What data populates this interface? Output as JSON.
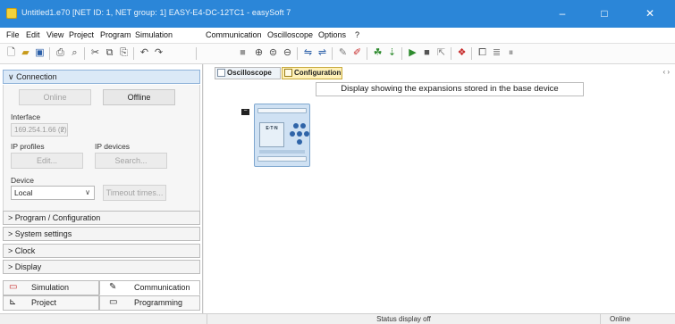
{
  "window": {
    "title": "Untitled1.e70 [NET ID: 1, NET group: 1] EASY-E4-DC-12TC1 - easySoft 7",
    "minimize": "–",
    "maximize": "□",
    "close": "✕",
    "titlebar_color": "#2b86d8"
  },
  "menu": {
    "items": [
      "File",
      "Edit",
      "View",
      "Project",
      "Program",
      "Simulation",
      "Communication",
      "Oscilloscope",
      "Options",
      "?"
    ]
  },
  "toolbar": {
    "icons": [
      "new-file-icon",
      "open-folder-icon",
      "save-icon",
      "print-icon",
      "print-preview-icon",
      "cut-icon",
      "copy-icon",
      "paste-icon",
      "undo-icon",
      "redo-icon",
      "fit-icon",
      "zoom-in-icon",
      "zoom-reset-icon",
      "zoom-out-icon",
      "connect-icon",
      "disconnect-icon",
      "tool-icon",
      "tool-red-icon",
      "run-icon",
      "step-icon",
      "play-icon",
      "stop-icon",
      "pause-icon",
      "bug-icon",
      "window-icon",
      "list-icon",
      "pause-bars-icon"
    ]
  },
  "left": {
    "connection": {
      "header": "∨ Connection",
      "online": "Online",
      "offline": "Offline",
      "interface_label": "Interface",
      "interface_value": "169.254.1.66 (2)",
      "ip_profiles_label": "IP profiles",
      "ip_devices_label": "IP devices",
      "edit": "Edit...",
      "search": "Search...",
      "device_label": "Device",
      "device_value": "Local",
      "timeout": "Timeout times..."
    },
    "sections": [
      "> Program / Configuration",
      "> System settings",
      "> Clock",
      "> Display"
    ],
    "bottom_tabs_row1": [
      "Simulation",
      "Communication"
    ],
    "bottom_tabs_row2": [
      "Project",
      "Programming"
    ]
  },
  "main": {
    "tabs": [
      "Oscilloscope",
      "Configuration"
    ],
    "active_tab": "Configuration",
    "info": "Display showing the expansions stored in the base device",
    "collapse": "−",
    "device_label": "E·T·N",
    "scroll_arrows": "‹ ›"
  },
  "status": {
    "center": "Status display off",
    "right": "Online"
  }
}
